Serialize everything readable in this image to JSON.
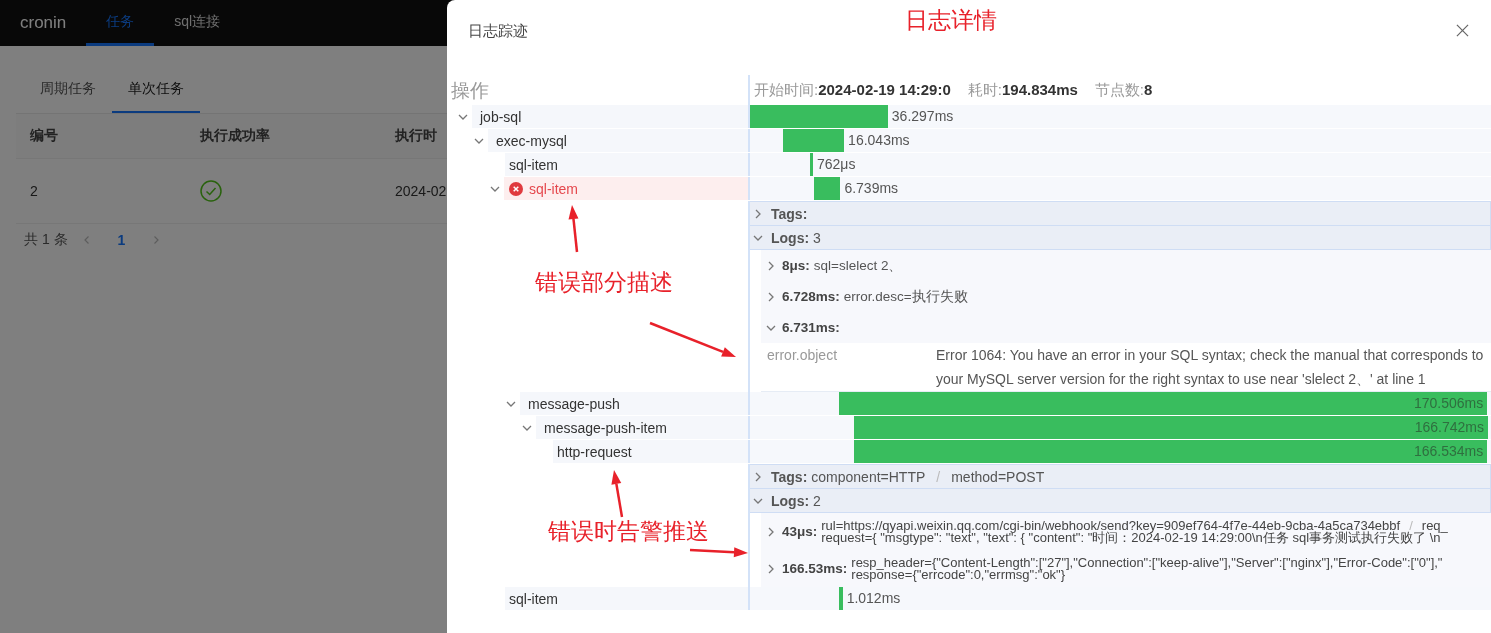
{
  "app": {
    "brand": "cronin",
    "nav": [
      {
        "label": "任务",
        "selected": true
      },
      {
        "label": "sql连接",
        "selected": false
      }
    ],
    "subtabs": [
      {
        "label": "周期任务",
        "selected": false
      },
      {
        "label": "单次任务",
        "selected": true
      }
    ],
    "table": {
      "columns": [
        "编号",
        "执行成功率",
        "执行时"
      ],
      "rows": [
        {
          "cells": [
            {
              "kind": "text",
              "text": "2"
            },
            {
              "kind": "check"
            },
            {
              "kind": "text",
              "text": "2024-02"
            }
          ]
        }
      ]
    },
    "pagination": {
      "total": "共 1 条",
      "pages": [
        {
          "label": "1",
          "selected": true
        }
      ]
    }
  },
  "drawer": {
    "title": "日志踪迹",
    "trace": {
      "column_header": "操作",
      "summary": [
        {
          "label": "开始时间:",
          "value": "2024-02-19 14:29:0"
        },
        {
          "label": "耗时:",
          "value": "194.834ms"
        },
        {
          "label": "节点数:",
          "value": "8"
        }
      ],
      "spans": [
        {
          "name": "job-sql",
          "duration": "36.297ms",
          "error": false,
          "expanded": true,
          "children": [
            {
              "name": "exec-mysql",
              "duration": "16.043ms",
              "error": false,
              "expanded": true,
              "children": [
                {
                  "name": "sql-item",
                  "duration": "762μs",
                  "error": false
                },
                {
                  "name": "sql-item",
                  "duration": "6.739ms",
                  "error": true,
                  "expanded": true,
                  "detail": {
                    "tags": {
                      "label": "Tags:",
                      "expanded": false
                    },
                    "logs": {
                      "label": "Logs:",
                      "count": "3",
                      "expanded": true,
                      "entries": [
                        {
                          "time": "8μs:",
                          "expanded": false,
                          "lines": [
                            [
                              "sql=slelect 2、"
                            ]
                          ]
                        },
                        {
                          "time": "6.728ms:",
                          "expanded": false,
                          "lines": [
                            [
                              "error.desc=执行失败"
                            ]
                          ]
                        },
                        {
                          "time": "6.731ms:",
                          "expanded": true,
                          "fields": [
                            {
                              "key": "error.object",
                              "value": "Error 1064: You have an error in your SQL syntax; check the manual that corresponds to your MySQL server version for the right syntax to use near 'slelect 2、' at line 1"
                            }
                          ]
                        }
                      ]
                    }
                  },
                  "children": [
                    {
                      "name": "message-push",
                      "duration": "170.506ms",
                      "error": false,
                      "expanded": true,
                      "children": [
                        {
                          "name": "message-push-item",
                          "duration": "166.742ms",
                          "error": false,
                          "expanded": true,
                          "children": [
                            {
                              "name": "http-request",
                              "duration": "166.534ms",
                              "error": false,
                              "detail": {
                                "separator": "/",
                                "tags": {
                                  "label": "Tags:",
                                  "expanded": false,
                                  "items": [
                                    "component=HTTP",
                                    "method=POST"
                                  ]
                                },
                                "logs": {
                                  "label": "Logs:",
                                  "count": "2",
                                  "expanded": true,
                                  "entries": [
                                    {
                                      "time": "43μs:",
                                      "expanded": false,
                                      "lines": [
                                        [
                                          "rul=https://qyapi.weixin.qq.com/cgi-bin/webhook/send?key=909ef764-4f7e-44eb-9cba-4a5ca734ebbf",
                                          "req_"
                                        ],
                                        [
                                          "request={ \"msgtype\": \"text\", \"text\": { \"content\": \"时间：2024-02-19 14:29:00\\n任务 sql事务测试执行失败了 \\n"
                                        ]
                                      ]
                                    },
                                    {
                                      "time": "166.53ms:",
                                      "expanded": false,
                                      "lines": [
                                        [
                                          "resp_header={\"Content-Length\":[\"27\"],\"Connection\":[\"keep-alive\"],\"Server\":[\"nginx\"],\"Error-Code\":[\"0\"],\""
                                        ],
                                        [
                                          "response={\"errcode\":0,\"errmsg\":\"ok\"}"
                                        ]
                                      ]
                                    }
                                  ]
                                }
                              }
                            }
                          ]
                        }
                      ]
                    }
                  ]
                },
                {
                  "name": "sql-item",
                  "duration": "1.012ms",
                  "error": false
                }
              ]
            }
          ]
        }
      ]
    }
  },
  "annotations": [
    {
      "text": "日志详情"
    },
    {
      "text": "错误部分描述"
    },
    {
      "text": "错误时告警推送"
    }
  ]
}
